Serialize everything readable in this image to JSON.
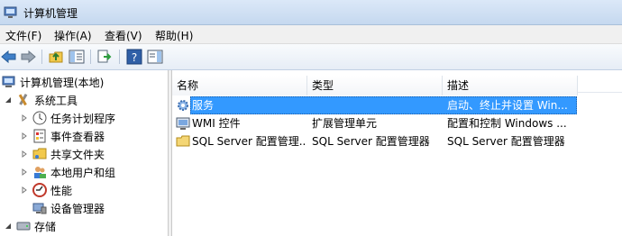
{
  "window": {
    "title": "计算机管理"
  },
  "menu": [
    "文件(F)",
    "操作(A)",
    "查看(V)",
    "帮助(H)"
  ],
  "toolbar": {
    "buttons": [
      "back-icon",
      "forward-icon",
      "up-folder-icon",
      "show-hide-tree-icon",
      "export-list-icon",
      "help-icon",
      "show-hide-action-pane-icon"
    ]
  },
  "tree": {
    "root": "计算机管理(本地)",
    "system_tools": "系统工具",
    "task_scheduler": "任务计划程序",
    "event_viewer": "事件查看器",
    "shared_folders": "共享文件夹",
    "local_users": "本地用户和组",
    "performance": "性能",
    "device_manager": "设备管理器",
    "storage": "存储"
  },
  "list": {
    "columns": [
      "名称",
      "类型",
      "描述"
    ],
    "rows": [
      {
        "name": "服务",
        "type": "",
        "desc": "启动、终止并设置 Win..."
      },
      {
        "name": "WMI 控件",
        "type": "扩展管理单元",
        "desc": "配置和控制 Windows ..."
      },
      {
        "name": "SQL Server 配置管理...",
        "type": "SQL Server 配置管理器",
        "desc": "SQL Server 配置管理器"
      }
    ]
  },
  "colors": {
    "selection": "#3399ff",
    "titlebar": "#c5d8ef"
  }
}
